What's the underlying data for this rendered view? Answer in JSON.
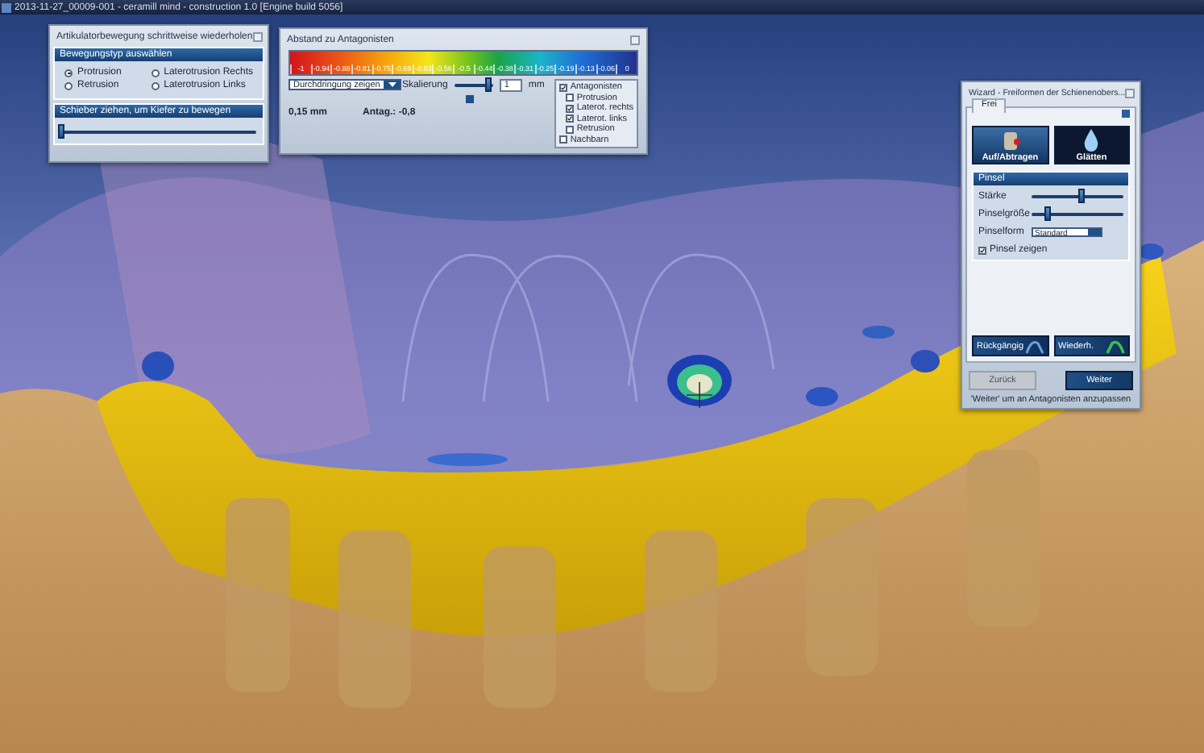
{
  "window": {
    "title": "2013-11-27_00009-001 - ceramill mind - construction 1.0 [Engine build 5056]"
  },
  "articulator_panel": {
    "title": "Artikulatorbewegung schrittweise wiederholen",
    "group_title": "Bewegungstyp auswählen",
    "options": [
      {
        "label": "Protrusion",
        "selected": true
      },
      {
        "label": "Laterotrusion Rechts",
        "selected": false
      },
      {
        "label": "Retrusion",
        "selected": false
      },
      {
        "label": "Laterotrusion Links",
        "selected": false
      }
    ],
    "slider_title": "Schieber ziehen, um Kiefer zu bewegen",
    "slider": {
      "level": 0.0
    }
  },
  "distance_panel": {
    "title": "Abstand zu Antagonisten",
    "scale_labels": [
      "-1",
      "-0.94",
      "-0.88",
      "-0.81",
      "-0.75",
      "-0.69",
      "-0.63",
      "-0.56",
      "-0.5",
      "-0.44",
      "-0.38",
      "-0.31",
      "-0.25",
      "-0.19",
      "-0.13",
      "-0.06",
      "0"
    ],
    "dropdown": "Durchdringung zeigen",
    "distance": "0,15 mm",
    "antag": "Antag.: -0,8",
    "scaling_label": "Skalierung",
    "scaling": {
      "level": 0.9
    },
    "scaling_value": "1",
    "unit": "mm",
    "checks": [
      {
        "label": "Antagonisten",
        "checked": true,
        "children": [
          {
            "label": "Protrusion",
            "checked": false
          },
          {
            "label": "Laterot. rechts",
            "checked": true
          },
          {
            "label": "Laterot. links",
            "checked": true
          },
          {
            "label": "Retrusion",
            "checked": false
          }
        ]
      },
      {
        "label": "Nachbarn",
        "checked": false
      }
    ]
  },
  "wizard": {
    "title": "Wizard - Freiformen der Schienenobers...",
    "tabs": [
      {
        "label": "Frei",
        "selected": true
      }
    ],
    "tools": [
      {
        "label": "Auf/Abtragen",
        "kind": "raise",
        "selected": false
      },
      {
        "label": "Glätten",
        "kind": "smooth",
        "selected": true
      }
    ],
    "brush_title": "Pinsel",
    "sliders": [
      {
        "label": "Stärke",
        "level": 0.55
      },
      {
        "label": "Pinselgröße",
        "level": 0.18
      }
    ],
    "shape_label": "Pinselform",
    "shape_value": "Standard",
    "show_brush": {
      "label": "Pinsel zeigen",
      "checked": true
    },
    "history": [
      {
        "label": "Rückgängig",
        "kind": "undo"
      },
      {
        "label": "Wiederh.",
        "kind": "redo"
      }
    ],
    "nav": [
      {
        "label": "Zurück",
        "disabled": true
      },
      {
        "label": "Weiter",
        "disabled": false
      }
    ],
    "hint": "'Weiter' um an Antagonisten anzupassen"
  }
}
